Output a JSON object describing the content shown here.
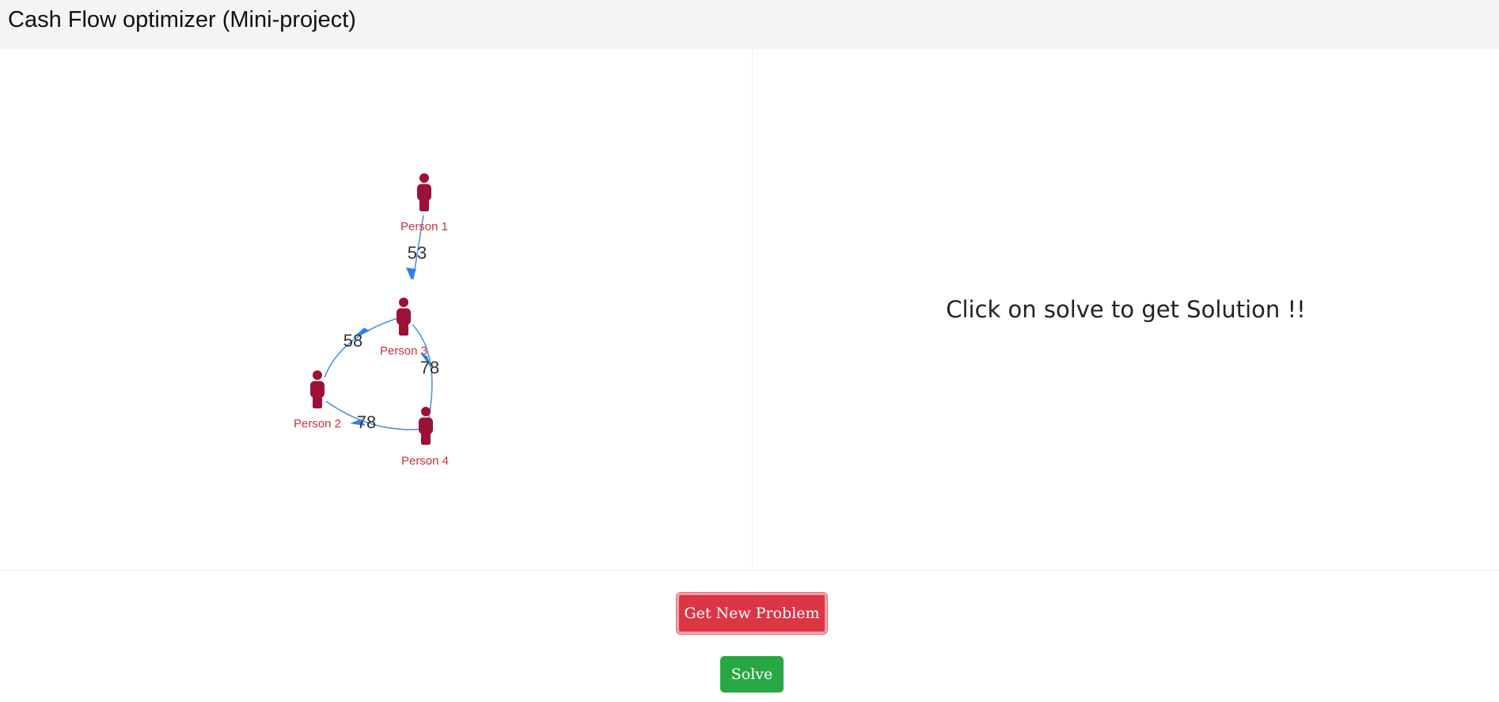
{
  "header": {
    "title": "Cash Flow optimizer (Mini-project)"
  },
  "graph": {
    "nodes": [
      {
        "id": "p1",
        "label": "Person 1"
      },
      {
        "id": "p2",
        "label": "Person 2"
      },
      {
        "id": "p3",
        "label": "Person 3"
      },
      {
        "id": "p4",
        "label": "Person 4"
      }
    ],
    "edges": [
      {
        "from": "Person 1",
        "to": "Person 3",
        "amount": "53"
      },
      {
        "from": "Person 2",
        "to": "Person 3",
        "amount": "58"
      },
      {
        "from": "Person 3",
        "to": "Person 4",
        "amount": "78"
      },
      {
        "from": "Person 4",
        "to": "Person 2",
        "amount": "78"
      }
    ],
    "colors": {
      "node": "#9b1236",
      "node_label": "#d0303f",
      "edge": "#4a8fe0",
      "arrow": "#2f7fe6"
    }
  },
  "solution": {
    "message": "Click on solve to get Solution !!"
  },
  "buttons": {
    "new_problem": "Get New Problem",
    "solve": "Solve"
  }
}
